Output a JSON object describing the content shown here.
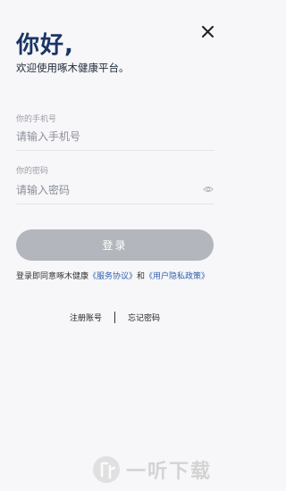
{
  "header": {
    "greeting": "你好,",
    "subtitle": "欢迎使用啄木健康平台。"
  },
  "phone": {
    "label": "你的手机号",
    "placeholder": "请输入手机号"
  },
  "password": {
    "label": "你的密码",
    "placeholder": "请输入密码"
  },
  "login_button": "登录",
  "agreement": {
    "prefix": "登录即同意啄木健康",
    "service_link": "《服务协议》",
    "and": "和",
    "privacy_link": "《用户隐私政策》"
  },
  "links": {
    "register": "注册账号",
    "forgot": "忘记密码"
  },
  "watermark": {
    "text": "一听下载"
  },
  "colors": {
    "background": "#f7f7f9",
    "title": "#1a3566",
    "button_disabled": "#b3b6bd",
    "link": "#2f5fb0"
  }
}
